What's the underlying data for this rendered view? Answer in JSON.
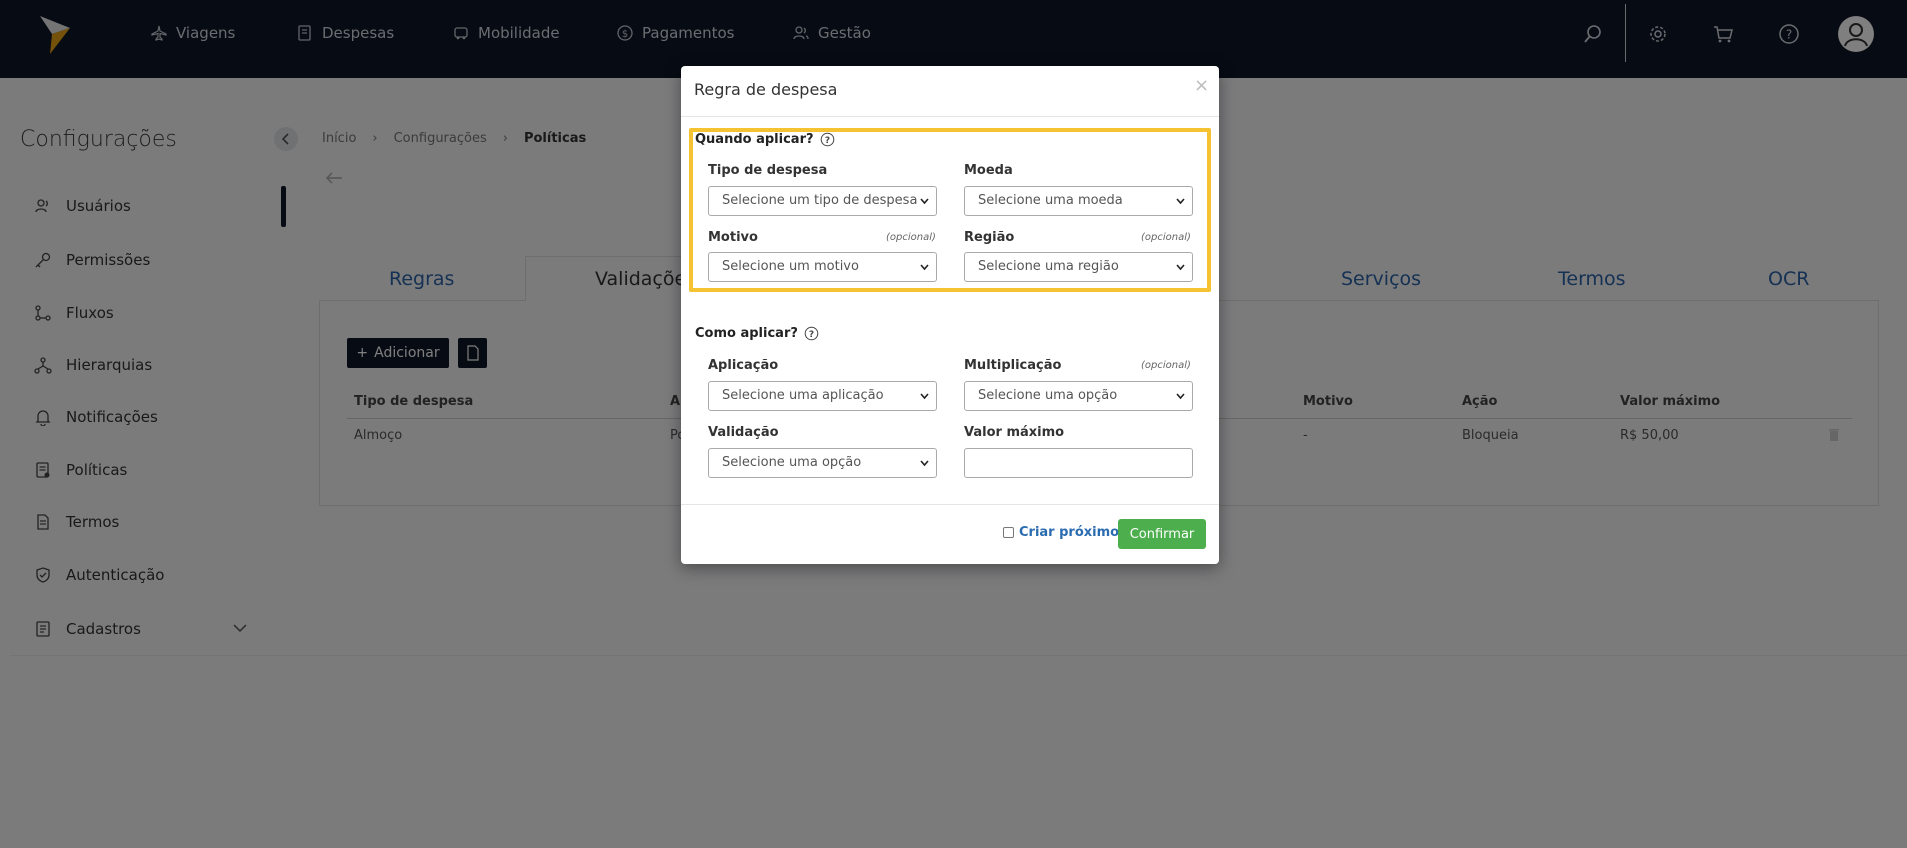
{
  "topbar": {
    "nav": [
      {
        "label": "Viagens",
        "icon": "plane-icon"
      },
      {
        "label": "Despesas",
        "icon": "receipt-icon"
      },
      {
        "label": "Mobilidade",
        "icon": "car-icon"
      },
      {
        "label": "Pagamentos",
        "icon": "dollar-icon"
      },
      {
        "label": "Gestão",
        "icon": "users-icon"
      }
    ],
    "icons": [
      "search-icon",
      "gear-icon",
      "cart-icon",
      "help-icon",
      "user-avatar-icon"
    ]
  },
  "sidebar": {
    "title": "Configurações",
    "items": [
      {
        "label": "Usuários",
        "icon": "users-icon"
      },
      {
        "label": "Permissões",
        "icon": "key-icon"
      },
      {
        "label": "Fluxos",
        "icon": "flow-icon"
      },
      {
        "label": "Hierarquias",
        "icon": "hierarchy-icon"
      },
      {
        "label": "Notificações",
        "icon": "bell-icon"
      },
      {
        "label": "Políticas",
        "icon": "policy-icon"
      },
      {
        "label": "Termos",
        "icon": "document-icon"
      },
      {
        "label": "Autenticação",
        "icon": "shield-icon"
      },
      {
        "label": "Cadastros",
        "icon": "register-icon"
      }
    ]
  },
  "breadcrumb": {
    "items": [
      "Início",
      "Configurações",
      "Políticas"
    ]
  },
  "tabs": {
    "items": [
      "Regras",
      "Validações",
      "Serviços",
      "Termos",
      "OCR"
    ],
    "active": "Validações"
  },
  "toolbar": {
    "add_label": "Adicionar"
  },
  "table": {
    "headers": {
      "tipo": "Tipo de despesa",
      "a": "A",
      "motivo": "Motivo",
      "acao": "Ação",
      "valor": "Valor máximo"
    },
    "rows": [
      {
        "tipo": "Almoço",
        "a": "Po",
        "motivo": "-",
        "acao": "Bloqueia",
        "valor": "R$ 50,00"
      }
    ]
  },
  "modal": {
    "title": "Regra de despesa",
    "close": "×",
    "when": {
      "title": "Quando aplicar?",
      "tipo_label": "Tipo de despesa",
      "tipo_placeholder": "Selecione um tipo de despesa",
      "moeda_label": "Moeda",
      "moeda_placeholder": "Selecione uma moeda",
      "motivo_label": "Motivo",
      "motivo_optional": "(opcional)",
      "motivo_placeholder": "Selecione um motivo",
      "regiao_label": "Região",
      "regiao_optional": "(opcional)",
      "regiao_placeholder": "Selecione uma região"
    },
    "how": {
      "title": "Como aplicar?",
      "aplicacao_label": "Aplicação",
      "aplicacao_placeholder": "Selecione uma aplicação",
      "mult_label": "Multiplicação",
      "mult_optional": "(opcional)",
      "mult_placeholder": "Selecione uma opção",
      "validacao_label": "Validação",
      "validacao_placeholder": "Selecione uma opção",
      "valor_label": "Valor máximo",
      "valor_value": ""
    },
    "footer": {
      "criar_label": "Criar próximo",
      "confirm_label": "Confirmar"
    }
  },
  "colors": {
    "topbar": "#0e1726",
    "highlight": "#f5c232",
    "confirm": "#4cae4c",
    "tab_link": "#2b63a6"
  }
}
